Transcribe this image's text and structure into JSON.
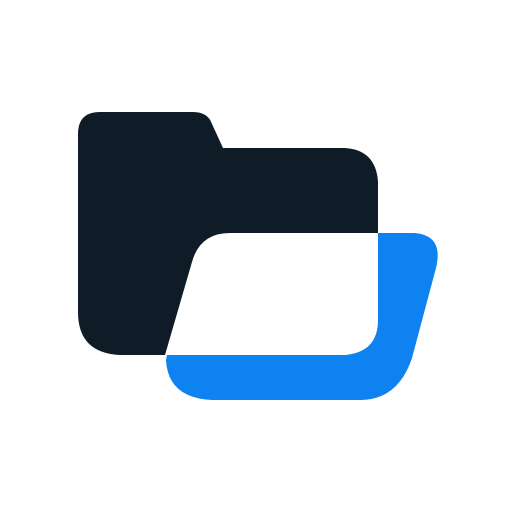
{
  "icon": {
    "name": "open-folder-icon",
    "colors": {
      "background": "#ffffff",
      "folder_back": "#0f1b27",
      "folder_front": "#0f82f2"
    }
  }
}
